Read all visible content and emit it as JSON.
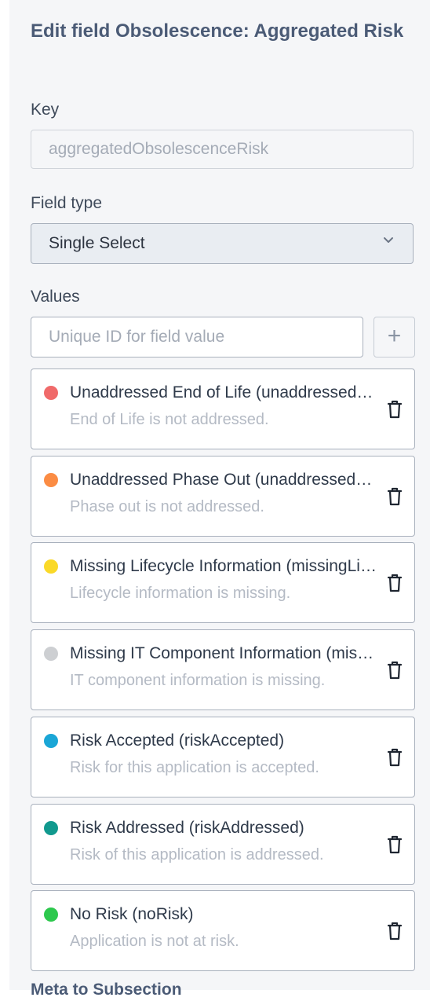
{
  "dialog": {
    "title": "Edit field Obsolescence: Aggregated Risk"
  },
  "key": {
    "label": "Key",
    "value": "aggregatedObsolescenceRisk"
  },
  "field_type": {
    "label": "Field type",
    "selected": "Single Select"
  },
  "values": {
    "label": "Values",
    "input_placeholder": "Unique ID for field value",
    "add_label": "+",
    "items": [
      {
        "name": "Unaddressed End of Life (unaddressedEndOfLife)",
        "description": "End of Life is not addressed.",
        "color": "#f06a6a"
      },
      {
        "name": "Unaddressed Phase Out (unaddressedPhaseOut)",
        "description": "Phase out is not addressed.",
        "color": "#fb8c44"
      },
      {
        "name": "Missing Lifecycle Information (missingLifecycleInformation)",
        "description": "Lifecycle information is missing.",
        "color": "#fad928"
      },
      {
        "name": "Missing IT Component Information (missingITComponentInformation)",
        "description": "IT component information is missing.",
        "color": "#cdcfd2"
      },
      {
        "name": "Risk Accepted (riskAccepted)",
        "description": "Risk for this application is accepted.",
        "color": "#1aa6d6"
      },
      {
        "name": "Risk Addressed (riskAddressed)",
        "description": "Risk of this application is addressed.",
        "color": "#11998e"
      },
      {
        "name": "No Risk (noRisk)",
        "description": "Application is not at risk.",
        "color": "#2dc84d"
      }
    ]
  },
  "next_section": {
    "title": "Meta to Subsection"
  }
}
